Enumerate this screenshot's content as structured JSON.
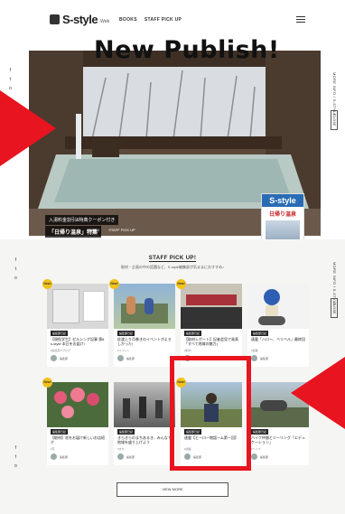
{
  "header": {
    "logo_text": "S-style",
    "logo_sub": "Web",
    "nav": [
      "BOOKS",
      "STAFF PICK UP"
    ]
  },
  "hero": {
    "title": "New Publish!",
    "caption_small": "入湯料金割引&特典クーポン付き",
    "caption_main": "「日帰り温泉」特集",
    "links": [
      "INDEX",
      "STAFF PICK UP"
    ],
    "foot_left": "Copyright 編集・発行",
    "foot_right": "最新・バックナンバーはこちら",
    "view_more": "VIEW MORE",
    "magazine": {
      "logo": "S-style",
      "headline": "日帰り温泉"
    },
    "side_text": "MORE INFO / S-STYLE",
    "side_tab": "CLOSE"
  },
  "staff": {
    "title": "STAFF PICK UP!",
    "subtitle": "取材・企画の中の話題など、S-style編集部が気ままにおすすめ♪",
    "side_text": "MORE INFO / S-STYLE",
    "side_tab": "CLOSE",
    "view_more": "VIEW MORE",
    "new_label": "New!",
    "cards": [
      {
        "cat": "編集部日記",
        "title": "【現役学生】ゼルシング記事 第8 s-style 本日をお届け!",
        "tag": "#編集部 #ブログ",
        "author": "編集部"
      },
      {
        "cat": "編集部日記",
        "title": "佐渡上り月巻きのイベントがよろしかった!",
        "tag": "#イベント",
        "author": "編集部"
      },
      {
        "cat": "編集部日記",
        "title": "【取材レポート】記者会見で発表「すべて地域の魅力」",
        "tag": "#取材",
        "author": "編集部"
      },
      {
        "cat": "編集部日記",
        "title": "連載「ハロー、ベリベル」最終回",
        "tag": "#連載",
        "author": "編集部"
      },
      {
        "cat": "編集部日記",
        "title": "【取材】花をお届け新しいお店紹介",
        "tag": "#花",
        "author": "編集部"
      },
      {
        "cat": "編集部日記",
        "title": "きらきらのまちあるき、みんなで地域を盛り上げよう",
        "tag": "#まち",
        "author": "編集部"
      },
      {
        "cat": "編集部日記",
        "title": "連載【ヒーロー物語ーム第一回】",
        "tag": "#連載",
        "author": "編集部"
      },
      {
        "cat": "編集部日記",
        "title": "バイク仲間とツーリング「エデュケーション」",
        "tag": "#バイク",
        "author": "編集部"
      }
    ]
  },
  "rails": {
    "icons": [
      "f",
      "t",
      "o"
    ]
  }
}
